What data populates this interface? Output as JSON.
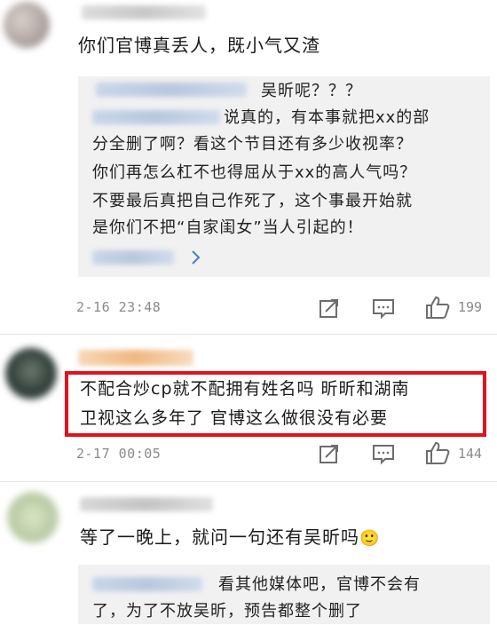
{
  "comments": [
    {
      "text": "你们官博真丢人，既小气又渣",
      "replies": {
        "reply1": "吴昕呢？？？",
        "reply2_lines": [
          "说真的，有本事就把xx的部",
          "分全删了啊？看这个节目还有多少收视率？",
          "你们再怎么杠不也得屈从于xx的高人气吗？",
          "不要最后真把自己作死了，这个事最开始就",
          "是你们不把“自家闺女”当人引起的！"
        ],
        "more_icon": "chevron-right-icon"
      },
      "timestamp": "2-16 23:48",
      "like_count": "199"
    },
    {
      "text_lines": [
        "不配合炒cp就不配拥有姓名吗  昕昕和湖南",
        "卫视这么多年了  官博这么做很没有必要"
      ],
      "timestamp": "2-17 00:05",
      "like_count": "144",
      "highlight_color": "#e0121e"
    },
    {
      "text": "等了一晚上，就问一句还有吴昕吗",
      "emoji": "🙂",
      "replies": {
        "reply_lines": [
          "看其他媒体吧，官博不会有",
          "了，为了不放吴昕，预告都整个删了"
        ]
      }
    }
  ],
  "icons": [
    "share-icon",
    "comment-icon",
    "like-icon"
  ]
}
